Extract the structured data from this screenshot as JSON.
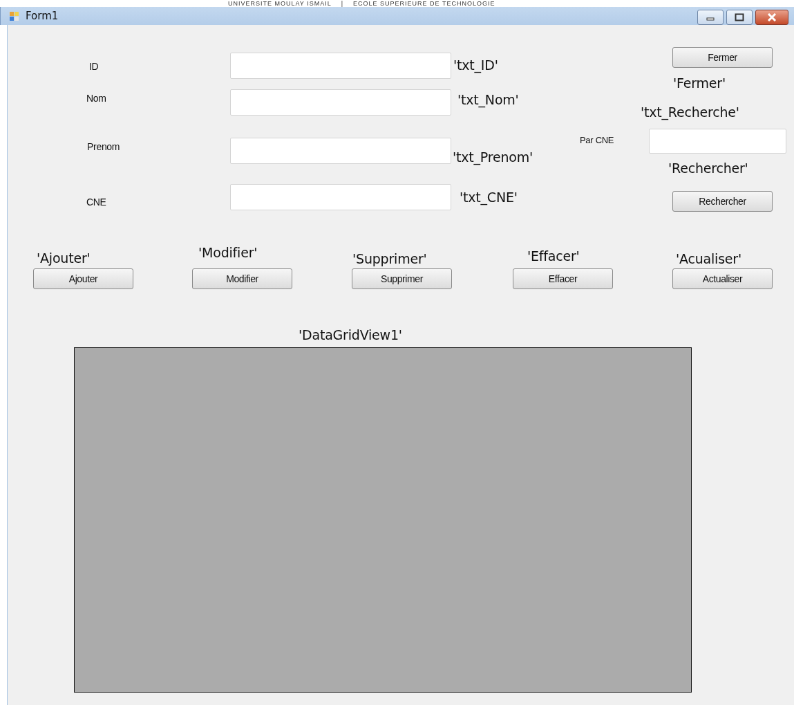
{
  "header": {
    "left": "UNIVERSITE MOULAY ISMAIL",
    "separator": "|",
    "right": "ECOLE SUPERIEURE DE TECHNOLOGIE"
  },
  "window": {
    "title": "Form1"
  },
  "controls": [
    {
      "kind": "label",
      "text": "ID"
    },
    {
      "kind": "textbox"
    },
    {
      "kind": "caption",
      "text": "'txt_ID'"
    },
    {
      "kind": "button",
      "text": "Fermer"
    },
    {
      "kind": "caption",
      "text": "'Fermer'"
    },
    {
      "kind": "label",
      "text": "Nom"
    },
    {
      "kind": "textbox"
    },
    {
      "kind": "caption",
      "text": "'txt_Nom'"
    },
    {
      "kind": "caption",
      "text": "'txt_Recherche'"
    },
    {
      "kind": "label",
      "text": "Par CNE"
    },
    {
      "kind": "textbox"
    },
    {
      "kind": "label",
      "text": "Prenom"
    },
    {
      "kind": "textbox"
    },
    {
      "kind": "caption",
      "text": "'txt_Prenom'"
    },
    {
      "kind": "caption",
      "text": "'Rechercher'"
    },
    {
      "kind": "label",
      "text": "CNE"
    },
    {
      "kind": "textbox"
    },
    {
      "kind": "caption",
      "text": "'txt_CNE'"
    },
    {
      "kind": "button",
      "text": "Rechercher"
    },
    {
      "kind": "caption",
      "text": "'Ajouter'"
    },
    {
      "kind": "caption",
      "text": "'Modifier'"
    },
    {
      "kind": "caption",
      "text": "'Supprimer'"
    },
    {
      "kind": "caption",
      "text": "'Effacer'"
    },
    {
      "kind": "caption",
      "text": "'Acualiser'"
    },
    {
      "kind": "button",
      "text": "Ajouter"
    },
    {
      "kind": "button",
      "text": "Modifier"
    },
    {
      "kind": "button",
      "text": "Supprimer"
    },
    {
      "kind": "button",
      "text": "Effacer"
    },
    {
      "kind": "button",
      "text": "Actualiser"
    },
    {
      "kind": "caption",
      "text": "'DataGridView1'"
    },
    {
      "kind": "grid"
    }
  ]
}
